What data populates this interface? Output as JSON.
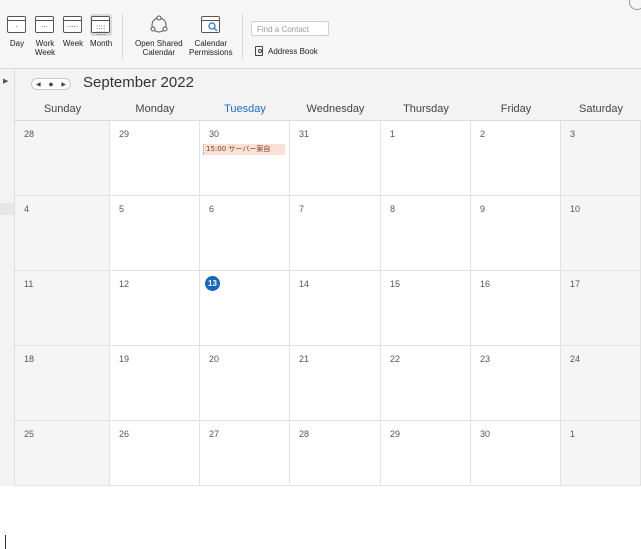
{
  "ribbon": {
    "buttons": [
      {
        "label": "Day",
        "icon": "day-view-icon"
      },
      {
        "label": "Work\nWeek",
        "icon": "work-week-view-icon"
      },
      {
        "label": "Week",
        "icon": "week-view-icon"
      },
      {
        "label": "Month",
        "icon": "month-view-icon",
        "active": true
      },
      {
        "label": "Open Shared\nCalendar",
        "icon": "shared-calendar-icon"
      },
      {
        "label": "Calendar\nPermissions",
        "icon": "calendar-permissions-icon"
      }
    ],
    "find_contact_placeholder": "Find a Contact",
    "address_book_label": "Address Book"
  },
  "nav": {
    "month_title": "September 2022",
    "prev_icon": "◀",
    "today_icon": "◆",
    "next_icon": "▶"
  },
  "weekdays": [
    "Sunday",
    "Monday",
    "Tuesday",
    "Wednesday",
    "Thursday",
    "Friday",
    "Saturday"
  ],
  "today_weekday_index": 2,
  "weeks": [
    [
      "28",
      "29",
      "30",
      "31",
      "1",
      "2",
      "3"
    ],
    [
      "4",
      "5",
      "6",
      "7",
      "8",
      "9",
      "10"
    ],
    [
      "11",
      "12",
      "13",
      "14",
      "15",
      "16",
      "17"
    ],
    [
      "18",
      "19",
      "20",
      "21",
      "22",
      "23",
      "24"
    ],
    [
      "25",
      "26",
      "27",
      "28",
      "29",
      "30",
      "1"
    ]
  ],
  "today_date": "13",
  "events": [
    {
      "week": 0,
      "day": 2,
      "text": "15:00 サーバー案自"
    }
  ],
  "colors": {
    "accent": "#1467c4",
    "event_bg": "#f8e1d6"
  }
}
